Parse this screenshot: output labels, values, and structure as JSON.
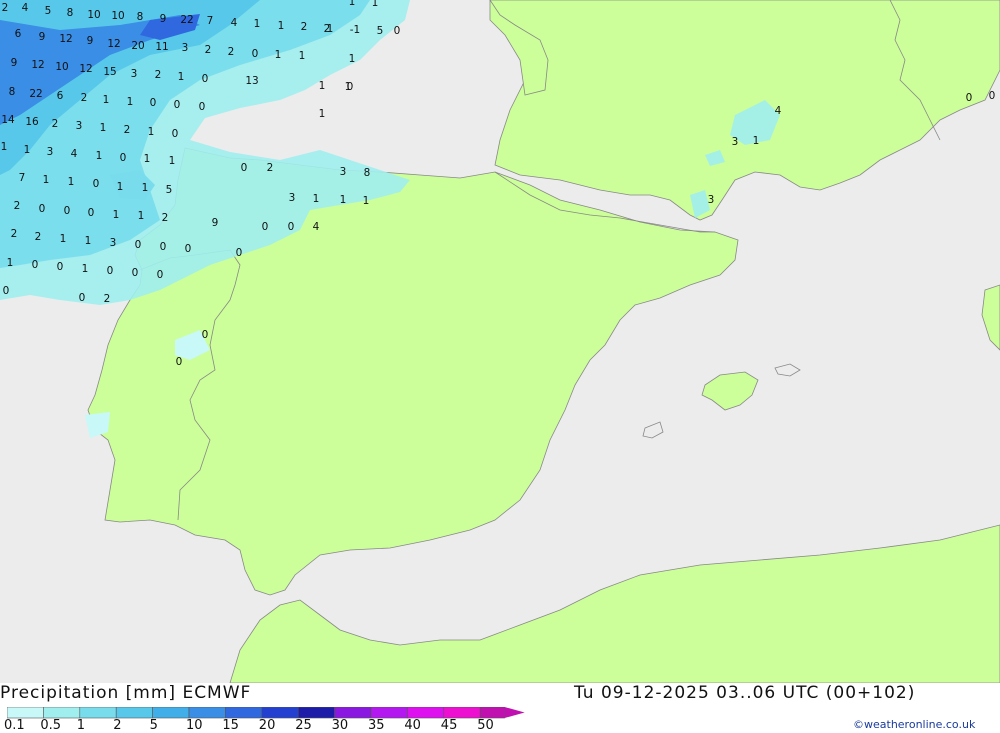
{
  "header": {
    "title": "Precipitation [mm] ECMWF",
    "valid_time": "Tu 09-12-2025 03..06 UTC (00+102)",
    "credit": "©weatheronline.co.uk"
  },
  "legend": {
    "labels": [
      "0.1",
      "0.5",
      "1",
      "2",
      "5",
      "10",
      "15",
      "20",
      "25",
      "30",
      "35",
      "40",
      "45",
      "50"
    ],
    "colors": [
      "#c8f8f8",
      "#a0eeee",
      "#78dcec",
      "#58c8ea",
      "#40aee8",
      "#3a8ee6",
      "#3068e0",
      "#2440d0",
      "#1c1ca8",
      "#8a18e0",
      "#b418f0",
      "#de10f0",
      "#ee10d0",
      "#c010b0"
    ]
  },
  "colors": {
    "sea": "#ececec",
    "land": "#ccff99",
    "border": "#888888"
  },
  "map_values": [
    "2",
    "4",
    "5",
    "8",
    "10",
    "10",
    "8",
    "9",
    "22",
    "7",
    "4",
    "1",
    "1",
    "2",
    "1",
    "-1",
    "5",
    "1",
    "1",
    "6",
    "9",
    "12",
    "9",
    "12",
    "20",
    "11",
    "3",
    "2",
    "2",
    "0",
    "1",
    "1",
    "2",
    "1",
    "0",
    "9",
    "12",
    "10",
    "12",
    "15",
    "3",
    "2",
    "1",
    "0",
    "0",
    "1",
    "13",
    "8",
    "22",
    "6",
    "2",
    "1",
    "1",
    "0",
    "0",
    "0",
    "1",
    "1",
    "14",
    "16",
    "2",
    "3",
    "1",
    "2",
    "1",
    "0",
    "4",
    "3",
    "1",
    "1",
    "1",
    "3",
    "4",
    "1",
    "0",
    "1",
    "1",
    "0",
    "2",
    "3",
    "8",
    "7",
    "1",
    "1",
    "0",
    "1",
    "1",
    "5",
    "3",
    "3",
    "1",
    "1",
    "2",
    "0",
    "0",
    "0",
    "1",
    "1",
    "2",
    "1",
    "9",
    "2",
    "2",
    "1",
    "1",
    "3",
    "0",
    "0",
    "0",
    "0",
    "0",
    "4",
    "1",
    "0",
    "0",
    "1",
    "0",
    "0",
    "0",
    "0",
    "0",
    "0",
    "2",
    "0",
    "0",
    "0",
    "0",
    "0",
    "0"
  ]
}
